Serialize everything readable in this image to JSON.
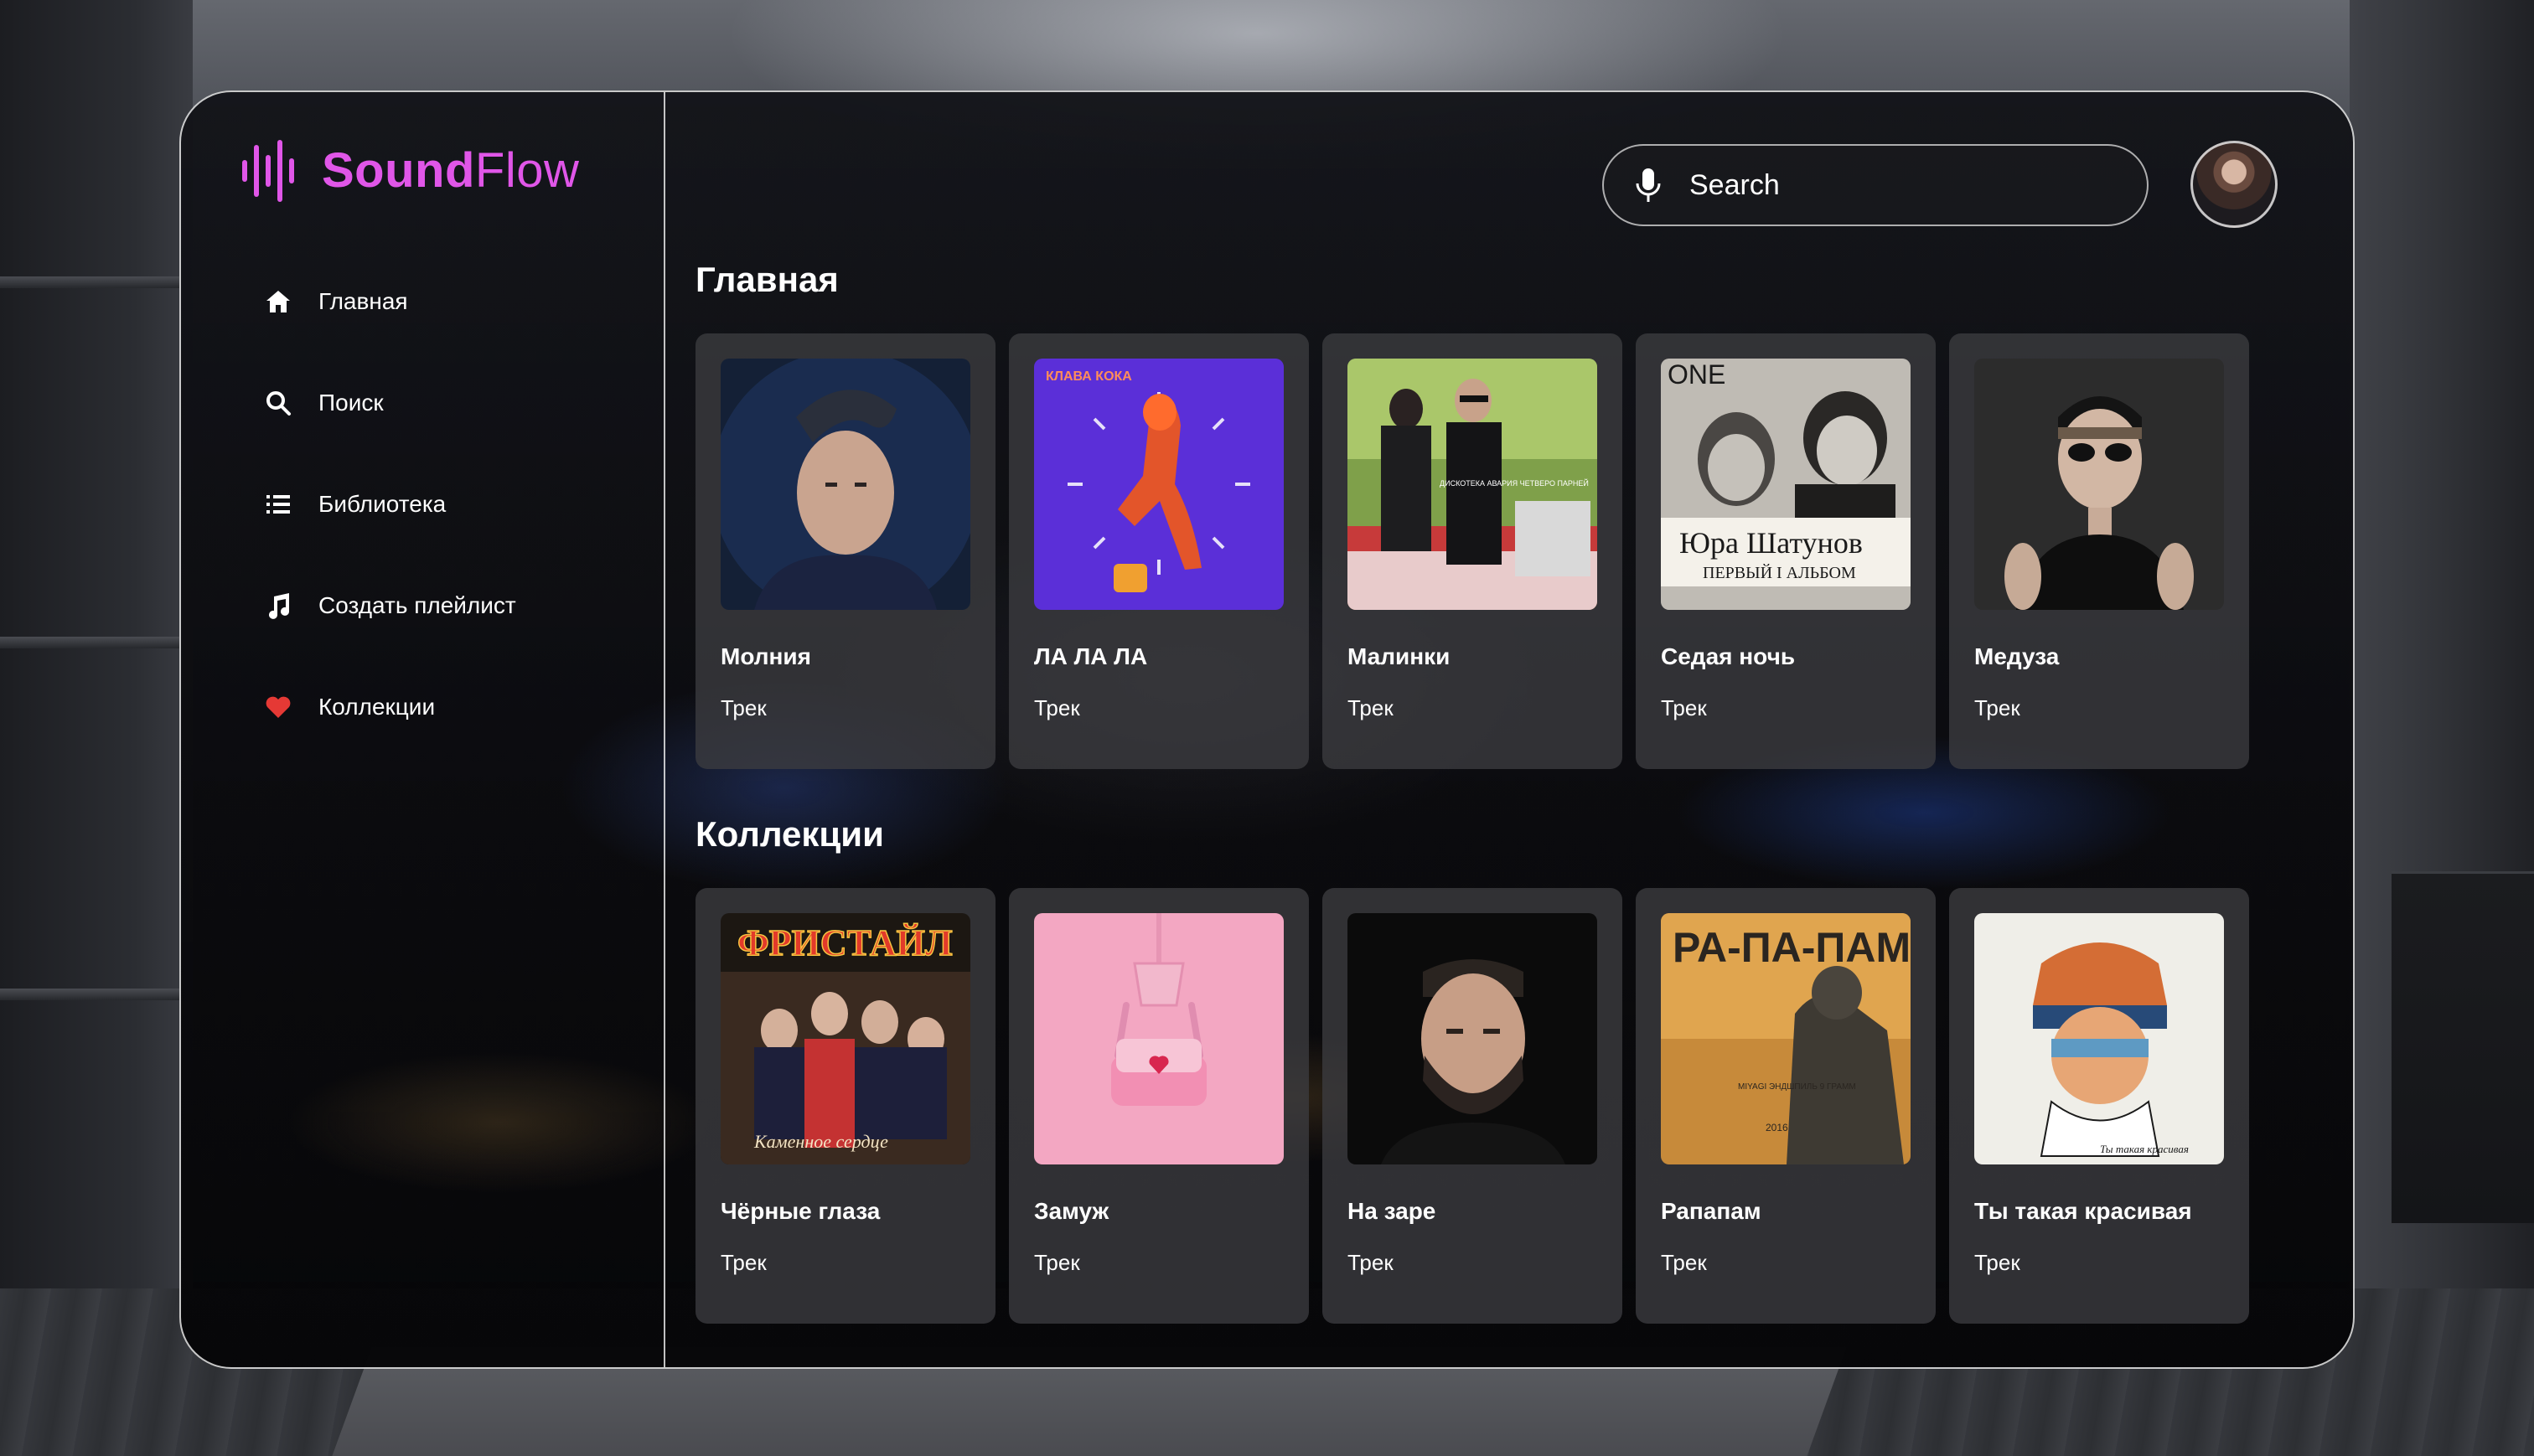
{
  "app": {
    "brand_bold": "Sound",
    "brand_light": "Flow",
    "accent": "#e056e8"
  },
  "sidebar": {
    "items": [
      {
        "label": "Главная",
        "icon": "home-icon"
      },
      {
        "label": "Поиск",
        "icon": "search-icon"
      },
      {
        "label": "Библиотека",
        "icon": "list-icon"
      },
      {
        "label": "Создать плейлист",
        "icon": "music-note-icon"
      },
      {
        "label": "Коллекции",
        "icon": "heart-icon",
        "icon_color": "#e53935"
      }
    ]
  },
  "header": {
    "search_placeholder": "Search",
    "search_icon": "microphone-icon",
    "avatar": "user-avatar"
  },
  "main": {
    "section_title": "Главная",
    "cards": [
      {
        "title": "Молния",
        "sub": "Трек"
      },
      {
        "title": "ЛА ЛА ЛА",
        "sub": "Трек",
        "cover_text": "КЛАВА КОКА"
      },
      {
        "title": "Малинки",
        "sub": "Трек",
        "cover_text": "ДИСКОТЕКА АВАРИЯ  ЧЕТВЕРО ПАРНЕЙ"
      },
      {
        "title": "Седая ночь",
        "sub": "Трек",
        "cover_text": "ONE",
        "cover_text2": "Юра Шатунов",
        "cover_text3": "ПЕРВЫЙ I АЛЬБОМ"
      },
      {
        "title": "Медуза",
        "sub": "Трек"
      }
    ]
  },
  "collections": {
    "section_title": "Коллекции",
    "cards": [
      {
        "title": "Чёрные глаза",
        "sub": "Трек",
        "cover_text": "ФРИСТАЙЛ",
        "cover_text2": "Каменное сердце"
      },
      {
        "title": "Замуж",
        "sub": "Трек"
      },
      {
        "title": "На заре",
        "sub": "Трек"
      },
      {
        "title": "Рапапам",
        "sub": "Трек",
        "cover_text": "РА-ПА-ПАМ",
        "cover_text2": "MIYAGI ЭНДШПИЛЬ 9 ГРАММ",
        "cover_text3": "2016"
      },
      {
        "title": "Ты такая красивая",
        "sub": "Трек",
        "cover_text": "Ты такая красивая"
      }
    ]
  }
}
